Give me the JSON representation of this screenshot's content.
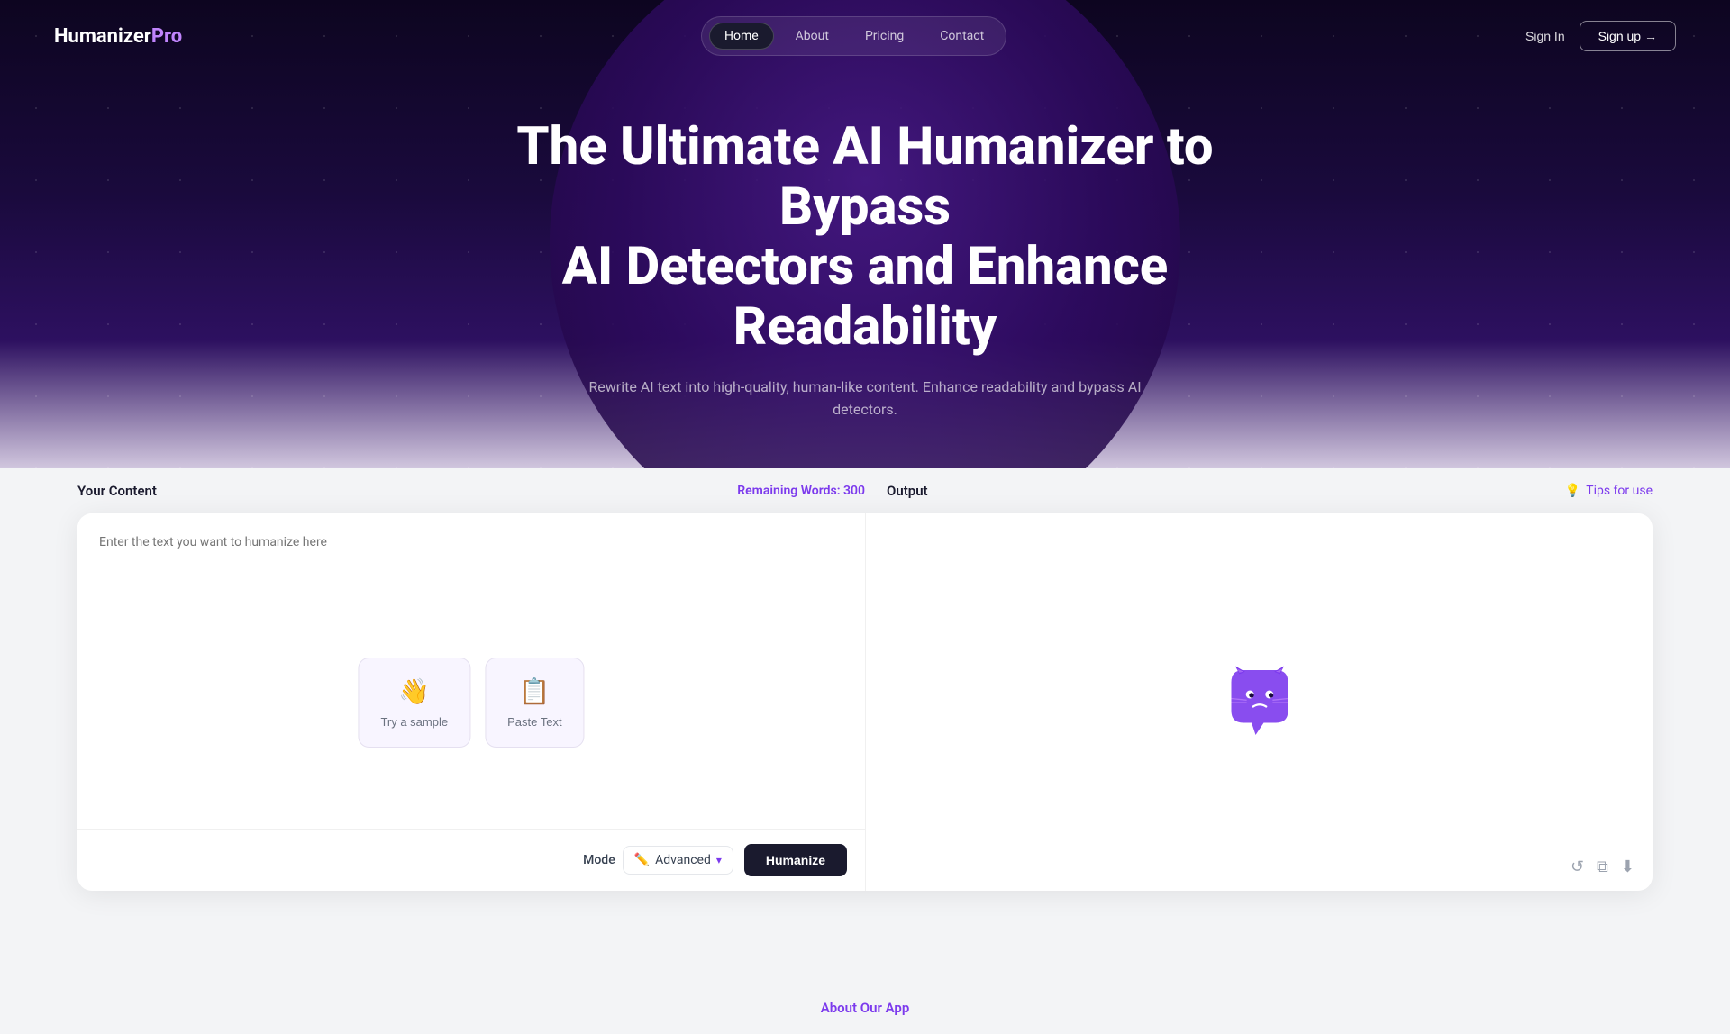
{
  "meta": {
    "title": "HumanizerPro"
  },
  "logo": {
    "text_white": "Humanizer",
    "text_purple": "Pro"
  },
  "nav": {
    "links": [
      {
        "label": "Home",
        "active": true
      },
      {
        "label": "About",
        "active": false
      },
      {
        "label": "Pricing",
        "active": false
      },
      {
        "label": "Contact",
        "active": false
      }
    ],
    "sign_in": "Sign In",
    "sign_up": "Sign up →"
  },
  "hero": {
    "title_line1": "The Ultimate AI Humanizer to Bypass",
    "title_line2": "AI Detectors and Enhance Readability",
    "subtitle": "Rewrite AI text into high-quality, human-like content. Enhance readability and bypass AI detectors."
  },
  "tool": {
    "your_content_label": "Your Content",
    "remaining_words_label": "Remaining Words: 300",
    "output_label": "Output",
    "tips_label": "Tips for use",
    "input_placeholder": "Enter the text you want to humanize here",
    "try_sample_label": "Try a sample",
    "paste_text_label": "Paste Text",
    "mode_label": "Mode",
    "mode_value": "Advanced",
    "humanize_btn": "Humanize"
  },
  "about": {
    "section_link": "About Our App"
  }
}
